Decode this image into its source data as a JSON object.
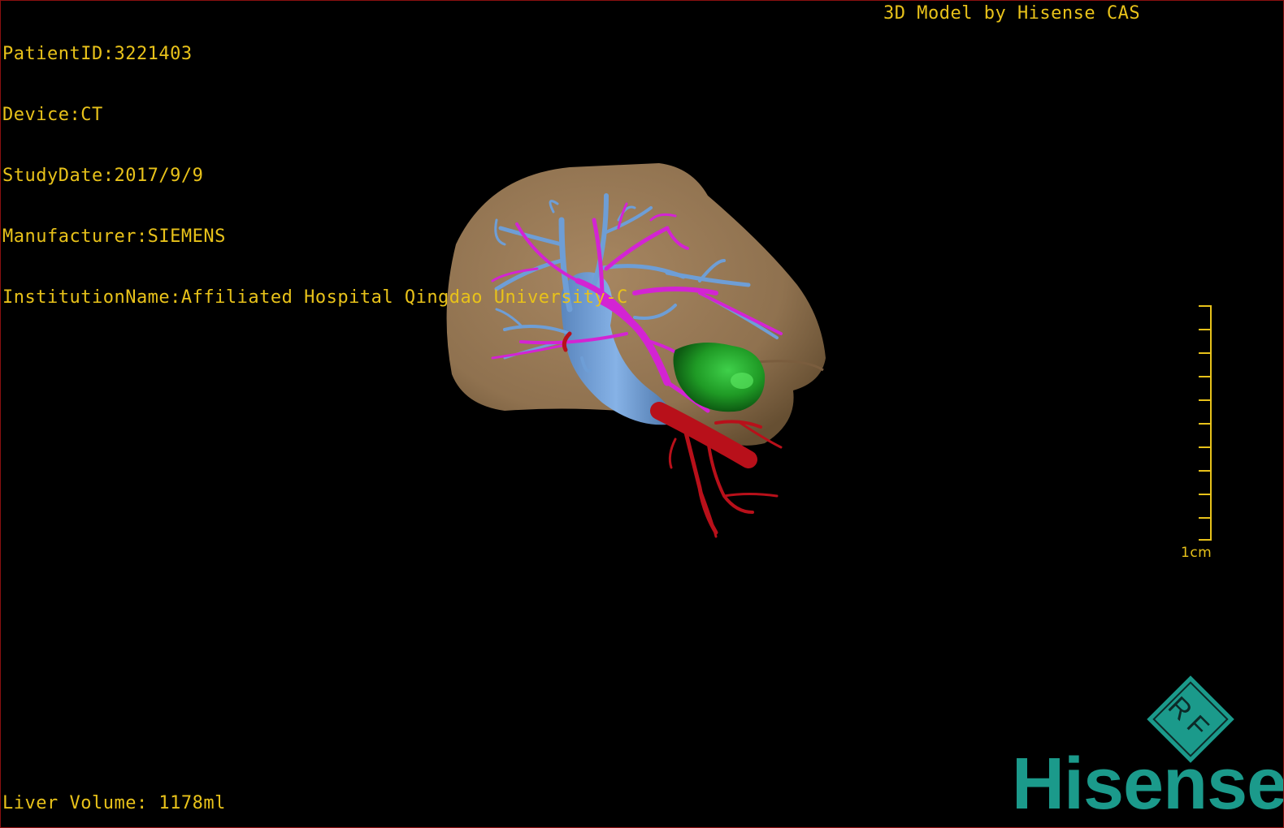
{
  "header": {
    "lines": [
      "PatientID:3221403",
      "Device:CT",
      "StudyDate:2017/9/9",
      "Manufacturer:SIEMENS",
      "InstitutionName:Affiliated Hospital Qingdao University-C"
    ],
    "title": "3D Model by Hisense CAS"
  },
  "footer": {
    "liver_volume": "Liver Volume: 1178ml"
  },
  "scale": {
    "label": "1cm"
  },
  "logo": {
    "badge_text": "RF",
    "brand": "Hisense",
    "brand_color": "#1b9a8b"
  },
  "model": {
    "colors": {
      "liver": "#a0805a",
      "portal_vein": "#d324d3",
      "hepatic_vein": "#6e9ed6",
      "ivc": "#6e9ed6",
      "artery": "#b8101a",
      "lesion": "#1f9a25"
    }
  }
}
